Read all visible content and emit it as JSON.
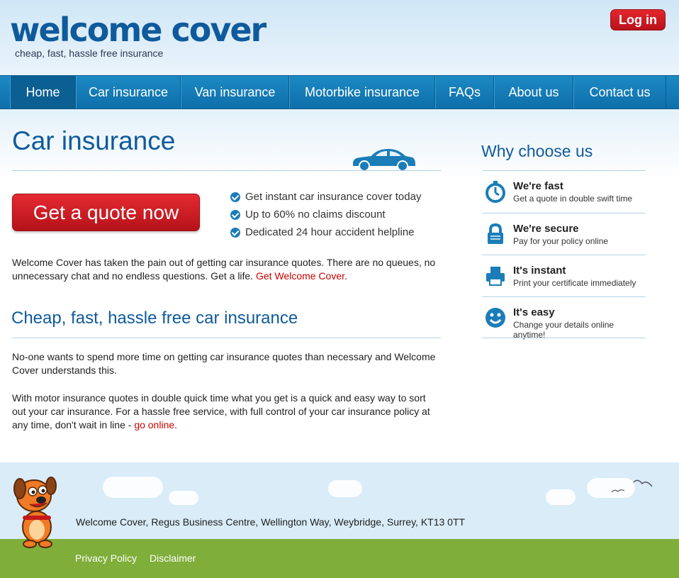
{
  "header": {
    "logo": "welcome cover",
    "tagline": "cheap, fast, hassle free insurance",
    "login_label": "Log in"
  },
  "nav": {
    "items": [
      "Home",
      "Car insurance",
      "Van insurance",
      "Motorbike insurance",
      "FAQs",
      "About us",
      "Contact us"
    ],
    "active": "Home"
  },
  "main": {
    "title": "Car insurance",
    "quote_button": "Get a quote now",
    "features": [
      "Get instant car insurance cover today",
      "Up to 60% no claims discount",
      "Dedicated 24 hour accident helpline"
    ],
    "intro": "Welcome Cover has taken the pain out of getting car insurance quotes. There are no queues, no unnecessary chat and no endless questions. Get a life.",
    "intro_link": "Get Welcome Cover",
    "subtitle": "Cheap, fast, hassle free car insurance",
    "para1": "No-one wants to spend more time on getting car insurance quotes than necessary and Welcome Cover understands this.",
    "para2": "With motor insurance quotes in double quick time what you get is a quick and easy way to sort out your car insurance. For a hassle free service, with full control of your car insurance policy at any time, don't wait in line -",
    "para2_link": "go online"
  },
  "sidebar": {
    "title": "Why choose us",
    "items": [
      {
        "title": "We're fast",
        "sub": "Get a quote in double swift time",
        "icon": "stopwatch-icon"
      },
      {
        "title": "We're secure",
        "sub": "Pay for your policy online",
        "icon": "lock-icon"
      },
      {
        "title": "It's instant",
        "sub": "Print your certificate immediately",
        "icon": "printer-icon"
      },
      {
        "title": "It's easy",
        "sub": "Change your details online anytime!",
        "icon": "smiley-icon"
      }
    ]
  },
  "footer": {
    "address": "Welcome Cover, Regus Business Centre, Wellington Way, Weybridge, Surrey, KT13 0TT",
    "links": [
      "Privacy Policy",
      "Disclaimer"
    ]
  },
  "colors": {
    "brand_blue": "#0f5a9c",
    "nav_blue": "#1480bd",
    "accent_red": "#cc0000",
    "grass_green": "#7fae3a"
  }
}
